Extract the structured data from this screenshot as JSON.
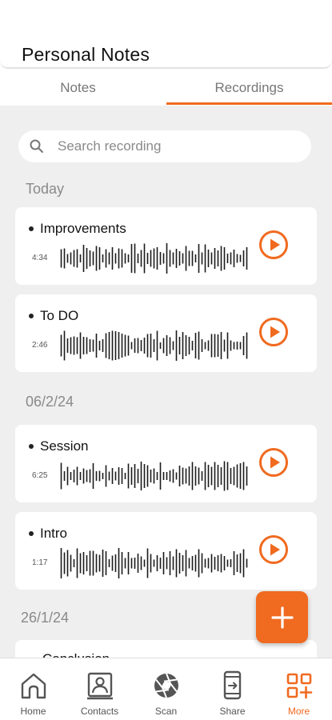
{
  "header": {
    "title": "Personal Notes"
  },
  "tabs": [
    {
      "label": "Notes",
      "active": false
    },
    {
      "label": "Recordings",
      "active": true
    }
  ],
  "search": {
    "placeholder": "Search recording",
    "value": ""
  },
  "sections": [
    {
      "label": "Today",
      "recordings": [
        {
          "title": "Improvements",
          "duration": "4:34"
        },
        {
          "title": "To DO",
          "duration": "2:46"
        }
      ]
    },
    {
      "label": "06/2/24",
      "recordings": [
        {
          "title": "Session",
          "duration": "6:25"
        },
        {
          "title": "Intro",
          "duration": "1:17"
        }
      ]
    },
    {
      "label": "26/1/24",
      "recordings": [
        {
          "title": "Conclusion",
          "duration": ""
        }
      ]
    }
  ],
  "nav": [
    {
      "label": "Home",
      "icon": "home-icon",
      "active": false
    },
    {
      "label": "Contacts",
      "icon": "contacts-icon",
      "active": false
    },
    {
      "label": "Scan",
      "icon": "camera-aperture-icon",
      "active": false
    },
    {
      "label": "Share",
      "icon": "share-device-icon",
      "active": false
    },
    {
      "label": "More",
      "icon": "grid-plus-icon",
      "active": true
    }
  ],
  "colors": {
    "accent": "#f06a1f",
    "background": "#efefef",
    "card": "#ffffff",
    "text": "#111111",
    "muted": "#8a8a8a"
  }
}
